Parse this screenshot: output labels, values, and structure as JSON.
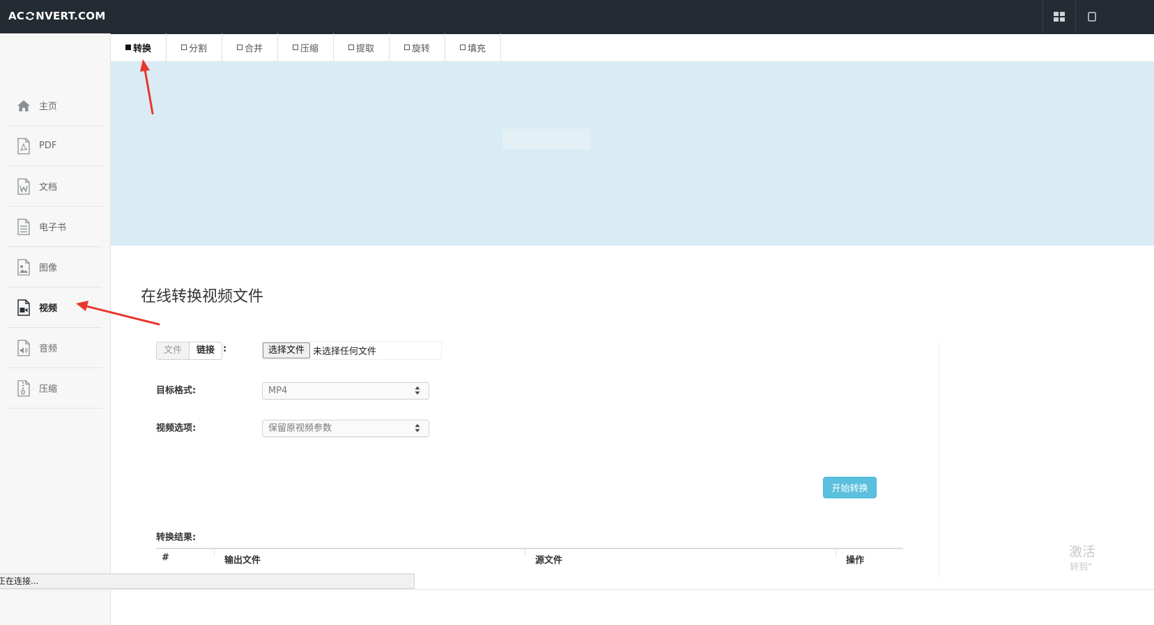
{
  "header": {
    "logo_left": "AC",
    "logo_right": "NVERT.COM"
  },
  "sidebar": {
    "items": [
      {
        "label": "主页",
        "icon": "home-icon"
      },
      {
        "label": "PDF",
        "icon": "pdf-file-icon"
      },
      {
        "label": "文档",
        "icon": "word-file-icon"
      },
      {
        "label": "电子书",
        "icon": "ebook-file-icon"
      },
      {
        "label": "图像",
        "icon": "image-file-icon"
      },
      {
        "label": "视频",
        "icon": "video-file-icon",
        "active": true
      },
      {
        "label": "音频",
        "icon": "audio-file-icon"
      },
      {
        "label": "压缩",
        "icon": "archive-file-icon"
      }
    ]
  },
  "tabs": [
    {
      "label": "转换",
      "active": true
    },
    {
      "label": "分割"
    },
    {
      "label": "合并"
    },
    {
      "label": "压缩"
    },
    {
      "label": "提取"
    },
    {
      "label": "旋转"
    },
    {
      "label": "填充"
    }
  ],
  "main": {
    "title": "在线转换视频文件",
    "source_toggle": {
      "file": "文件",
      "link": "链接",
      "colon": ":"
    },
    "file_input": {
      "button": "选择文件",
      "status": "未选择任何文件"
    },
    "target_format": {
      "label": "目标格式:",
      "value": "MP4"
    },
    "video_options": {
      "label": "视频选项:",
      "value": "保留原视频参数"
    },
    "start_button": "开始转换",
    "results": {
      "label": "转换结果:",
      "columns": [
        "#",
        "输出文件",
        "源文件",
        "操作"
      ]
    }
  },
  "status_bar": {
    "text": "正在连接..."
  },
  "watermark": {
    "line1": "激活",
    "line2": "转到\""
  },
  "colors": {
    "header_bg": "#252b33",
    "banner_bg": "#d9ecf5",
    "accent_button": "#5bc0de",
    "annotation_arrow": "#e8362c"
  }
}
